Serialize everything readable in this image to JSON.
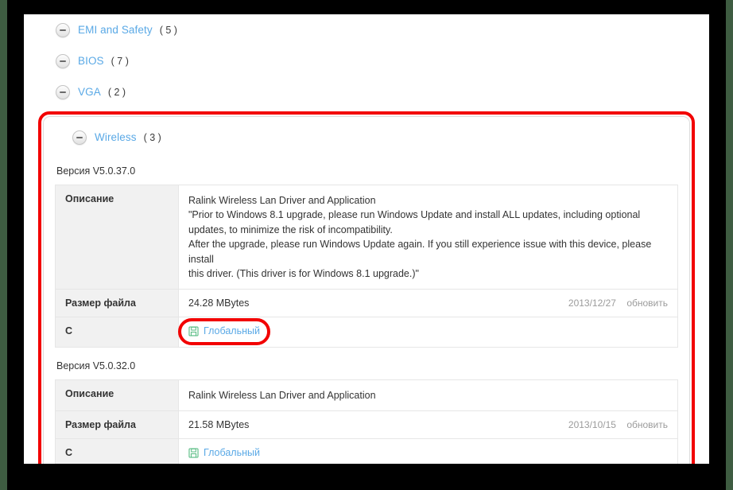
{
  "page": {
    "accent_link_color": "#5aa9e6",
    "highlight_color": "#f20000",
    "label_bg_color": "#f1f1f1"
  },
  "categories": [
    {
      "name": "EMI and Safety",
      "count": "( 5 )",
      "toggle": "minus-circle-icon"
    },
    {
      "name": "BIOS",
      "count": "( 7 )",
      "toggle": "minus-circle-icon"
    },
    {
      "name": "VGA",
      "count": "( 2 )",
      "toggle": "minus-circle-icon"
    }
  ],
  "highlighted_category": {
    "name": "Wireless",
    "count": "( 3 )",
    "toggle": "minus-circle-icon"
  },
  "releases": [
    {
      "version_label": "Версия V5.0.37.0",
      "rows": {
        "description_label": "Описание",
        "description_lines": [
          "Ralink Wireless Lan Driver and Application",
          "\"Prior to Windows 8.1 upgrade, please run Windows Update and install ALL updates, including optional",
          "updates, to minimize the risk of incompatibility.",
          "After the upgrade, please run Windows Update again. If you still experience issue with this device, please install",
          "this driver. (This driver is for Windows 8.1 upgrade.)\""
        ],
        "filesize_label": "Размер файла",
        "filesize_value": "24.28 MBytes",
        "date": "2013/12/27",
        "update_label": "обновить",
        "download_label": "C",
        "download_link_text": "Глобальный",
        "download_icon": "floppy-disk-icon"
      }
    },
    {
      "version_label": "Версия V5.0.32.0",
      "rows": {
        "description_label": "Описание",
        "description_lines": [
          "Ralink Wireless Lan Driver and Application"
        ],
        "filesize_label": "Размер файла",
        "filesize_value": "21.58 MBytes",
        "date": "2013/10/15",
        "update_label": "обновить",
        "download_label": "C",
        "download_link_text": "Глобальный",
        "download_icon": "floppy-disk-icon"
      }
    }
  ]
}
